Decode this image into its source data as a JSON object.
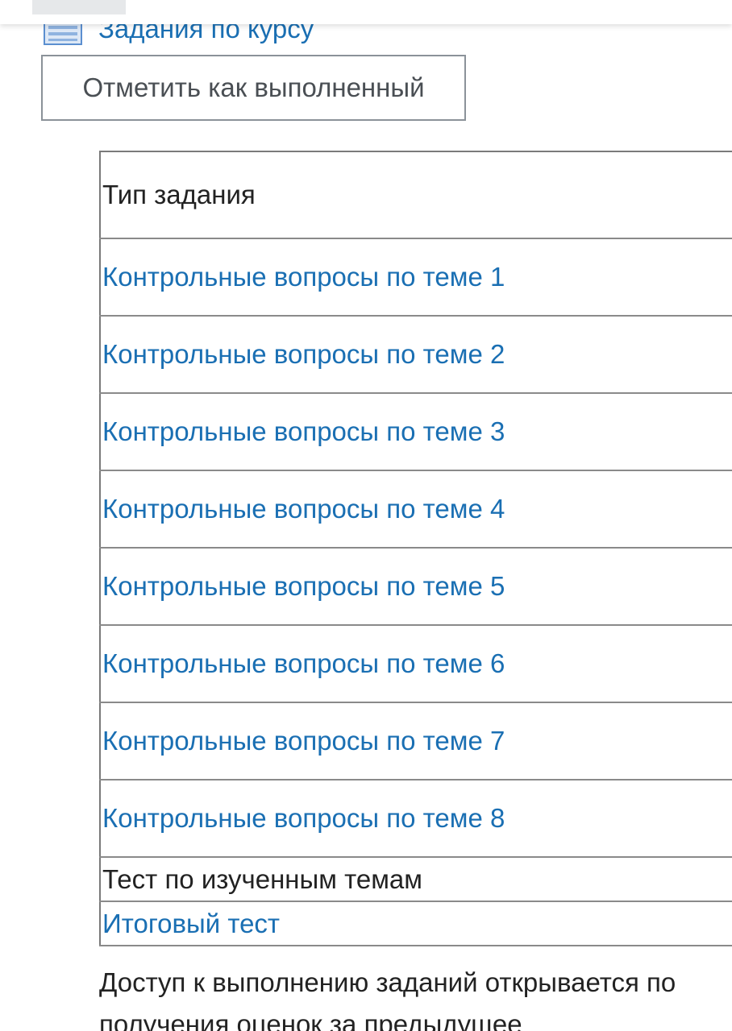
{
  "activity": {
    "icon": "assignment-icon",
    "link_text": "Задания по курсу"
  },
  "completion_button": {
    "label": "Отметить как выполненный"
  },
  "task_table": {
    "header": "Тип задания",
    "rows": [
      {
        "text": "Контрольные вопросы по теме 1",
        "is_link": true
      },
      {
        "text": "Контрольные вопросы по теме 2",
        "is_link": true
      },
      {
        "text": "Контрольные вопросы по теме 3",
        "is_link": true
      },
      {
        "text": "Контрольные вопросы по теме 4",
        "is_link": true
      },
      {
        "text": "Контрольные вопросы по теме 5",
        "is_link": true
      },
      {
        "text": "Контрольные вопросы по теме 6",
        "is_link": true
      },
      {
        "text": "Контрольные вопросы по теме 7",
        "is_link": true
      },
      {
        "text": "Контрольные вопросы по теме 8",
        "is_link": true
      },
      {
        "text": "Тест по изученным темам",
        "is_link": false
      },
      {
        "text": "Итоговый тест",
        "is_link": true
      }
    ]
  },
  "note": {
    "line1": "Доступ к выполнению заданий открывается по",
    "line2": "получения оценок за предыдущее"
  },
  "colors": {
    "link": "#1a6fb3",
    "text": "#222222",
    "button_border": "#8b9299"
  }
}
